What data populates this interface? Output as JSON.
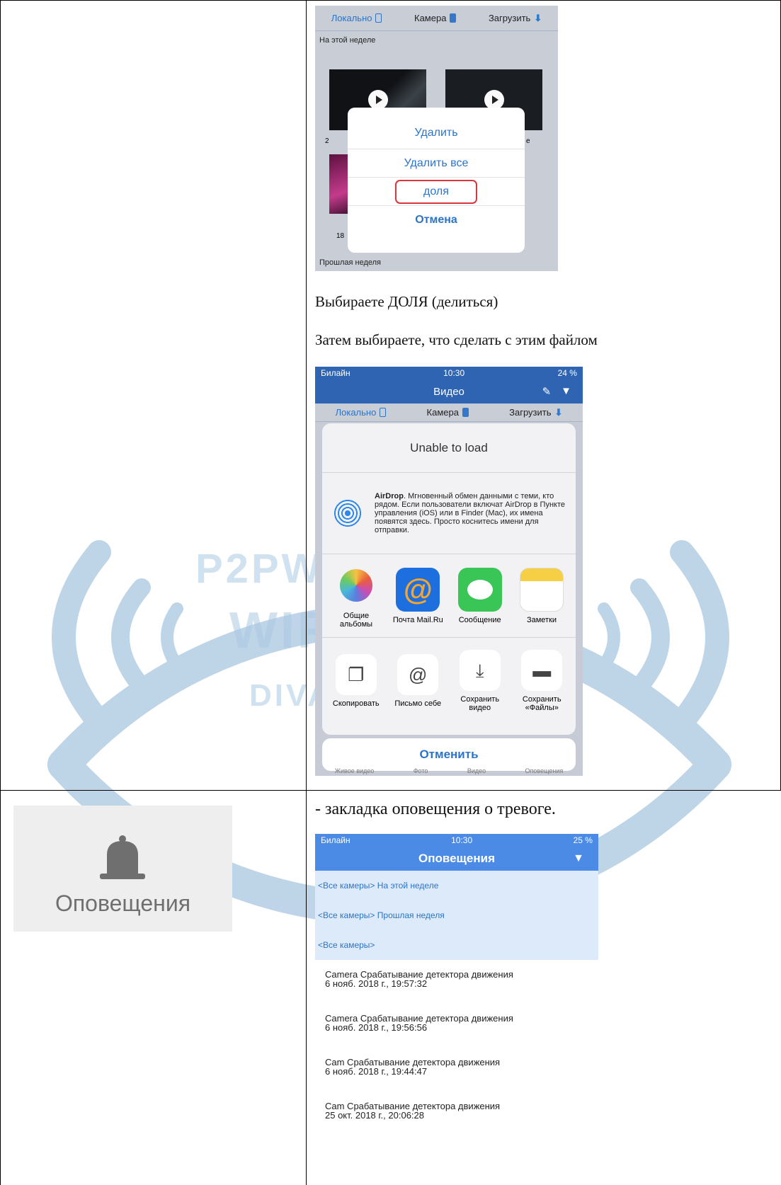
{
  "screenshot1": {
    "tabs": [
      "Локально",
      "Камера",
      "Загрузить"
    ],
    "section_this_week": "На этой неделе",
    "thumb_label_1": "2",
    "thumb_label_2": "e",
    "thumb_label_3": "18",
    "menu": [
      "Удалить",
      "Удалить все",
      "доля",
      "Отмена"
    ],
    "section_last_week": "Прошлая неделя"
  },
  "caption1": "Выбираете ДОЛЯ (делиться)",
  "caption2": "Затем выбираете, что сделать с этим файлом",
  "screenshot2": {
    "status": {
      "carrier": "Билайн",
      "time": "10:30",
      "battery": "24 %"
    },
    "nav_title": "Видео",
    "tabs": [
      "Локально",
      "Камера",
      "Загрузить"
    ],
    "unable": "Unable to load",
    "airdrop_bold": "AirDrop",
    "airdrop_text": ". Мгновенный обмен данными с теми, кто рядом. Если пользователи включат AirDrop в Пункте управления (iOS) или в Finder (Mac), их имена появятся здесь. Просто коснитесь имени для отправки.",
    "apps": [
      "Общие альбомы",
      "Почта Mail.Ru",
      "Сообщение",
      "Заметки"
    ],
    "actions": [
      "Скопировать",
      "Письмо себе",
      "Сохранить видео",
      "Сохранить «Файлы»"
    ],
    "cancel": "Отменить",
    "tabbar": [
      "Живое видео",
      "Фото",
      "Видео",
      "Оповещения"
    ]
  },
  "caption3": "- закладка оповещения о тревоге.",
  "notif_icon_label": "Оповещения",
  "screenshot3": {
    "status": {
      "carrier": "Билайн",
      "time": "10:30",
      "battery": "25 %"
    },
    "title": "Оповещения",
    "filters": [
      "<Все камеры> На этой неделе",
      "<Все камеры> Прошлая неделя",
      "<Все камеры>"
    ],
    "events": [
      {
        "title": "Camera Срабатывание детектора движения",
        "time": "6 нояб. 2018 г., 19:57:32"
      },
      {
        "title": "Camera Срабатывание детектора движения",
        "time": "6 нояб. 2018 г., 19:56:56"
      },
      {
        "title": "Cam Срабатывание детектора движения",
        "time": "6 нояб. 2018 г., 19:44:47"
      },
      {
        "title": "Cam Срабатывание детектора движения",
        "time": "25 окт. 2018 г., 20:06:28"
      }
    ]
  },
  "watermark": {
    "line1": "P2PWIFICAM.RU",
    "line2": "WIFISEC.RU",
    "line3": "DIVARY.RU"
  },
  "colors": {
    "accent": "#2b74c8",
    "nav_blue": "#2e64b1",
    "highlight_red": "#d8363c",
    "watermark": "#a9c6e0"
  }
}
